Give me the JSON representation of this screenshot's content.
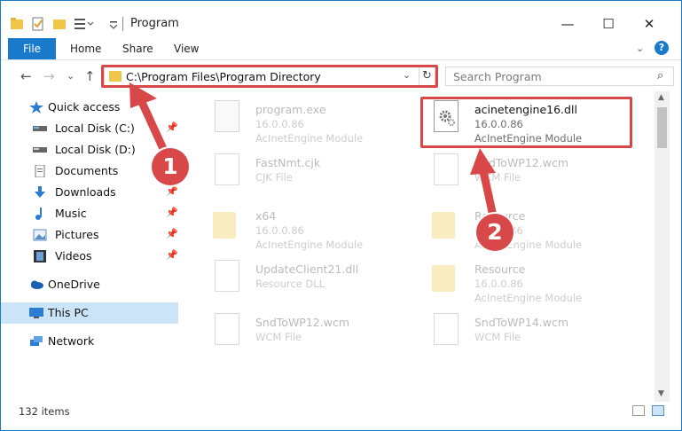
{
  "window": {
    "title": "Program",
    "controls": {
      "minimize": "—",
      "maximize": "☐",
      "close": "✕"
    }
  },
  "ribbon": {
    "tabs": [
      {
        "label": "File"
      },
      {
        "label": "Home"
      },
      {
        "label": "Share"
      },
      {
        "label": "View"
      }
    ],
    "collapse_glyph": "⌄",
    "help_glyph": "?"
  },
  "address": {
    "path": "C:\\Program Files\\Program Directory",
    "dropdown_glyph": "⌄",
    "refresh_glyph": "↻",
    "nav": {
      "back": "←",
      "forward": "→",
      "recent": "⌄",
      "up": "↑"
    }
  },
  "search": {
    "placeholder": "Search Program",
    "icon": "⌕"
  },
  "nav_pane": {
    "items": [
      {
        "label": "Quick access",
        "icon": "star-icon"
      },
      {
        "label": "Local Disk (C:)",
        "icon": "drive-icon",
        "pinned": true
      },
      {
        "label": "Local Disk (D:)",
        "icon": "drive-icon"
      },
      {
        "label": "Documents",
        "icon": "documents-icon",
        "pinned": true
      },
      {
        "label": "Downloads",
        "icon": "download-icon",
        "pinned": true
      },
      {
        "label": "Music",
        "icon": "music-icon",
        "pinned": true
      },
      {
        "label": "Pictures",
        "icon": "pictures-icon",
        "pinned": true
      },
      {
        "label": "Videos",
        "icon": "video-icon",
        "pinned": true
      },
      {
        "label": "OneDrive",
        "icon": "cloud-icon"
      },
      {
        "label": "This PC",
        "icon": "computer-icon",
        "selected": true
      },
      {
        "label": "Network",
        "icon": "network-icon"
      }
    ],
    "pin_glyph": "📌"
  },
  "files": [
    {
      "name": "program.exe",
      "line2": "16.0.0.86",
      "line3": "AcInetEngine Module",
      "icon": "exe-icon",
      "blurred": true
    },
    {
      "name": "acinetengine16.dll",
      "line2": "16.0.0.86",
      "line3": "AcInetEngine Module",
      "icon": "dll-gear-icon",
      "blurred": false,
      "highlighted": true
    },
    {
      "name": "FastNmt.cjk",
      "line2": "CJK File",
      "line3": "",
      "icon": "file-icon",
      "blurred": true
    },
    {
      "name": "SndToWP12.wcm",
      "line2": "WCM File",
      "line3": "",
      "icon": "file-icon",
      "blurred": true
    },
    {
      "name": "x64",
      "line2": "16.0.0.86",
      "line3": "AcInetEngine Module",
      "icon": "folder-icon",
      "blurred": true
    },
    {
      "name": "Resource",
      "line2": "16.0.0.86",
      "line3": "AcInetEngine Module",
      "icon": "folder-icon",
      "blurred": true
    },
    {
      "name": "UpdateClient21.dll",
      "line2": "Resource DLL",
      "line3": "",
      "icon": "dll-gear-icon",
      "blurred": true
    },
    {
      "name": "Resource",
      "line2": "16.0.0.86",
      "line3": "AcInetEngine Module",
      "icon": "folder-icon",
      "blurred": true
    },
    {
      "name": "SndToWP12.wcm",
      "line2": "WCM File",
      "line3": "",
      "icon": "file-icon",
      "blurred": true
    },
    {
      "name": "SndToWP14.wcm",
      "line2": "WCM File",
      "line3": "",
      "icon": "file-icon",
      "blurred": true
    }
  ],
  "status": {
    "item_count": "132 items"
  },
  "annotations": [
    {
      "label": "1",
      "target": "address-bar"
    },
    {
      "label": "2",
      "target": "acinetengine16.dll"
    }
  ],
  "colors": {
    "accent": "#1979ca",
    "highlight": "#d94848",
    "selected": "#cce4f7",
    "folder": "#f0c64a"
  }
}
